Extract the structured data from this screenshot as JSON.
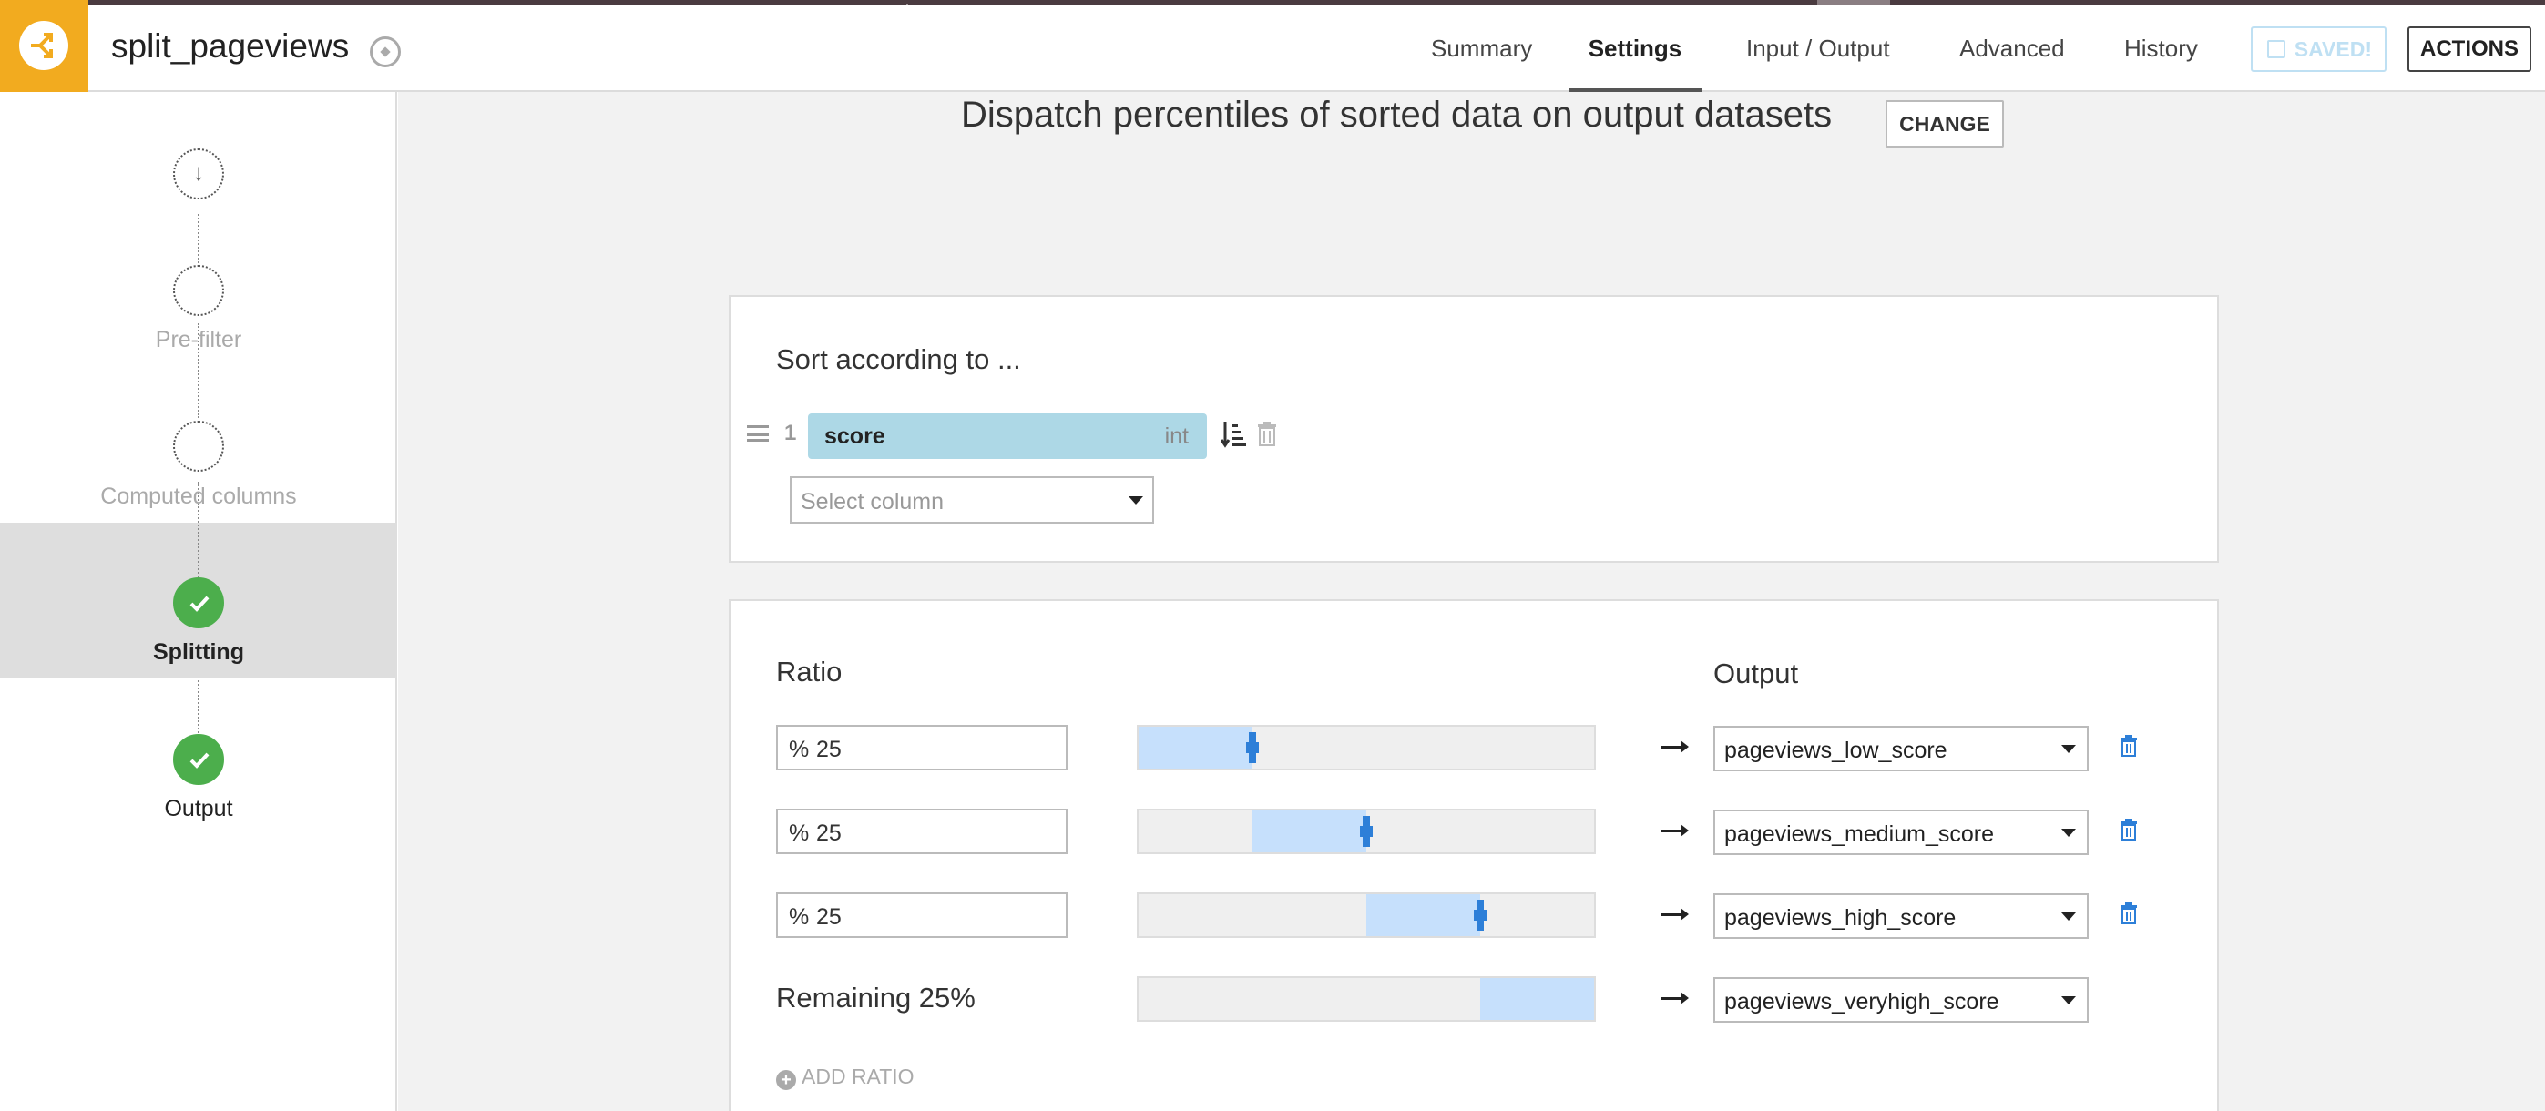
{
  "header": {
    "recipe_title": "split_pageviews",
    "tabs": [
      {
        "label": "Summary"
      },
      {
        "label": "Settings"
      },
      {
        "label": "Input / Output"
      },
      {
        "label": "Advanced"
      },
      {
        "label": "History"
      }
    ],
    "active_tab": "Settings",
    "saved_label": "SAVED!",
    "actions_label": "ACTIONS"
  },
  "sidebar": {
    "steps": [
      {
        "label": "",
        "state": "start"
      },
      {
        "label": "Pre-filter",
        "state": "inactive"
      },
      {
        "label": "Computed columns",
        "state": "inactive"
      },
      {
        "label": "Splitting",
        "state": "done",
        "selected": true
      },
      {
        "label": "Output",
        "state": "done"
      }
    ]
  },
  "main": {
    "heading": "Dispatch percentiles of sorted data on output datasets",
    "change_label": "CHANGE",
    "sort": {
      "title": "Sort according to ...",
      "columns": [
        {
          "index": "1",
          "name": "score",
          "type": "int"
        }
      ],
      "select_placeholder": "Select column"
    },
    "ratio": {
      "ratio_header": "Ratio",
      "output_header": "Output",
      "rows": [
        {
          "percent_symbol": "%",
          "value": "25",
          "fill_start": 0.0,
          "fill_end": 0.25,
          "output": "pageviews_low_score"
        },
        {
          "percent_symbol": "%",
          "value": "25",
          "fill_start": 0.25,
          "fill_end": 0.5,
          "output": "pageviews_medium_score"
        },
        {
          "percent_symbol": "%",
          "value": "25",
          "fill_start": 0.5,
          "fill_end": 0.75,
          "output": "pageviews_high_score"
        }
      ],
      "remaining": {
        "label": "Remaining 25%",
        "fill_start": 0.75,
        "fill_end": 1.0,
        "output": "pageviews_veryhigh_score"
      },
      "add_label": "ADD RATIO"
    }
  },
  "colors": {
    "brand": "#f2ab1f",
    "success": "#4cae4c",
    "accent": "#2d7fd8",
    "chip": "#add8e6",
    "fill": "#c6e0fc"
  }
}
